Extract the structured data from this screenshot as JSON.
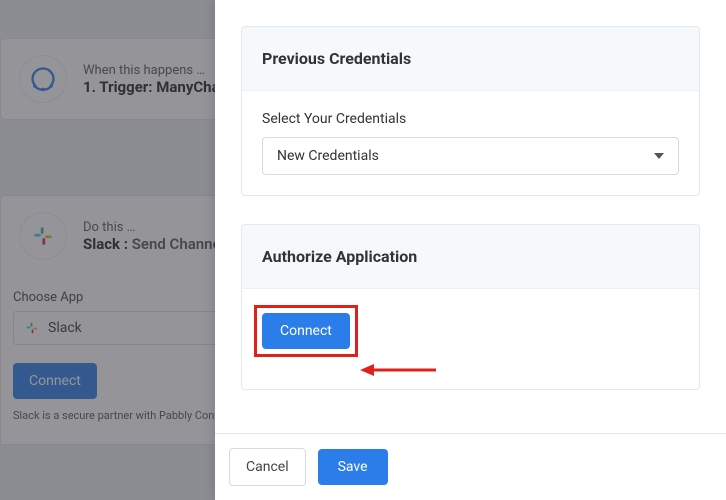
{
  "bg": {
    "step1": {
      "sub": "When this happens …",
      "main_prefix": "1. Trigger: ",
      "main_app": "ManyChat"
    },
    "step2": {
      "sub": "Do this …",
      "main_app": "Slack : ",
      "main_action": "Send Channel"
    },
    "choose_label": "Choose App",
    "app_name": "Slack",
    "connect_label": "Connect",
    "secure_text": "Slack is a secure partner with Pabbly Connect"
  },
  "panel": {
    "card1_title": "Previous Credentials",
    "field_label": "Select Your Credentials",
    "select_value": "New Credentials",
    "card2_title": "Authorize Application",
    "connect_label": "Connect",
    "cancel_label": "Cancel",
    "save_label": "Save"
  }
}
